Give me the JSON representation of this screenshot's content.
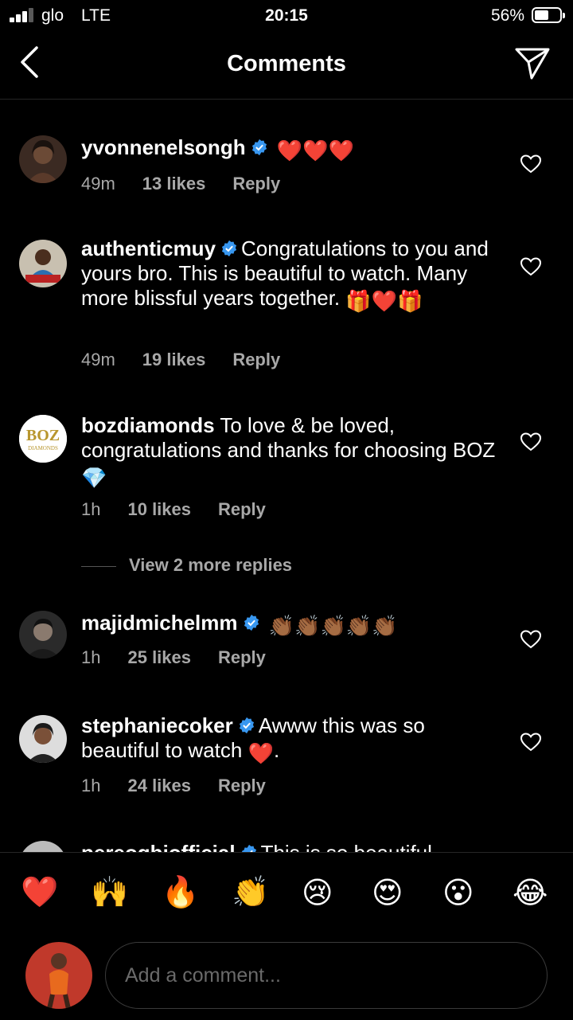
{
  "status": {
    "carrier": "glo",
    "network": "LTE",
    "time": "20:15",
    "battery": "56%",
    "battery_level": 0.56
  },
  "header": {
    "title": "Comments"
  },
  "comments": [
    {
      "user": "yvonnenelsongh",
      "verified": true,
      "text": "",
      "emojis": "❤️❤️❤️",
      "time": "49m",
      "likes": "13 likes",
      "reply": "Reply"
    },
    {
      "user": "authenticmuy",
      "verified": true,
      "text": "Congratulations to you and yours bro. This is beautiful to watch. Many more blissful years together.",
      "emojis": "🎁❤️🎁",
      "time": "49m",
      "likes": "19 likes",
      "reply": "Reply"
    },
    {
      "user": "bozdiamonds",
      "verified": false,
      "text": "To love & be loved, congratulations and thanks for choosing BOZ",
      "emojis": "💎",
      "time": "1h",
      "likes": "10 likes",
      "reply": "Reply"
    },
    {
      "user": "majidmichelmm",
      "verified": true,
      "text": "",
      "emojis": "👏🏾👏🏾👏🏾👏🏾👏🏾",
      "time": "1h",
      "likes": "25 likes",
      "reply": "Reply"
    },
    {
      "user": "stephaniecoker",
      "verified": true,
      "text": "Awww this was so beautiful to watch",
      "emojis": "❤️",
      "suffix": ".",
      "time": "1h",
      "likes": "24 likes",
      "reply": "Reply"
    },
    {
      "user": "pereogbiofficial",
      "verified": true,
      "text": "This is so beautiful"
    }
  ],
  "view_more": "View 2 more replies",
  "reactions": [
    "❤️",
    "🙌",
    "🔥",
    "👏",
    "😢",
    "😍",
    "😮",
    "😂"
  ],
  "input": {
    "placeholder": "Add a comment..."
  },
  "colors": {
    "verified": "#3897f0",
    "meta": "#a8a8a8",
    "background": "#000000"
  }
}
